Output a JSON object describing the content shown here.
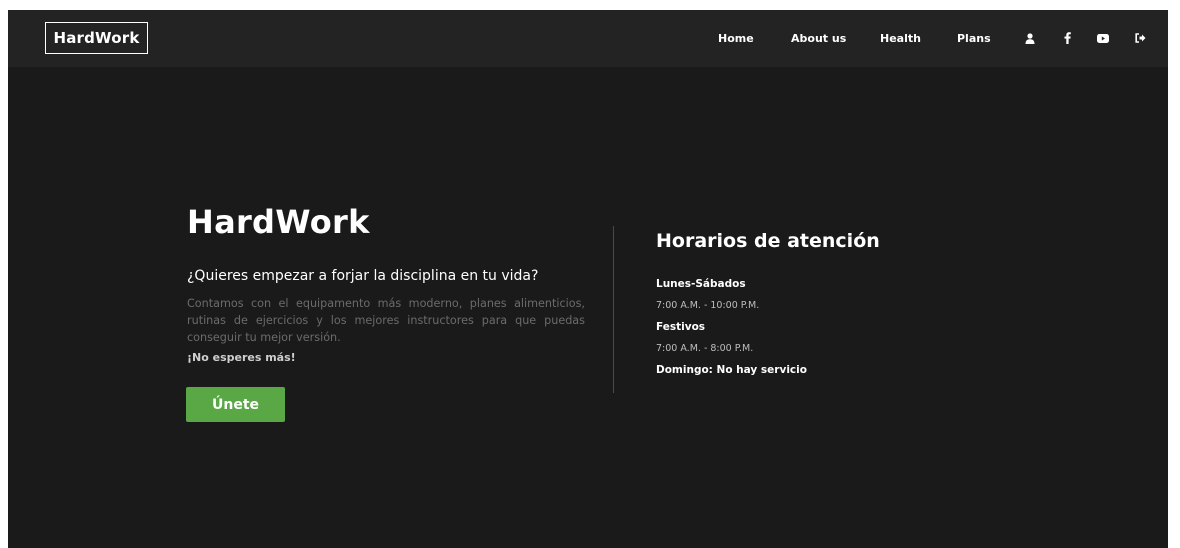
{
  "navbar": {
    "brand": "HardWork",
    "links": [
      "Home",
      "About us",
      "Health",
      "Plans"
    ],
    "icons": [
      "user-icon",
      "facebook-icon",
      "youtube-icon",
      "logout-icon"
    ]
  },
  "hero": {
    "title": "HardWork",
    "question": "¿Quieres empezar a forjar la disciplina en tu vida?",
    "description": "Contamos con el equipamento más moderno, planes alimenticios, rutinas de ejercicios y los mejores instructores para que puedas conseguir tu mejor versión.",
    "cta_text": "¡No esperes más!",
    "button_label": "Únete"
  },
  "schedule": {
    "title": "Horarios de atención",
    "weekdays_label": "Lunes-Sábados",
    "weekdays_hours": "7:00 A.M. - 10:00 P.M.",
    "holidays_label": "Festivos",
    "holidays_hours": "7:00 A.M. - 8:00 P.M.",
    "sunday": "Domingo: No hay servicio"
  },
  "colors": {
    "background": "#1a1a1b",
    "navbar": "#232324",
    "accent": "#5aa845"
  }
}
